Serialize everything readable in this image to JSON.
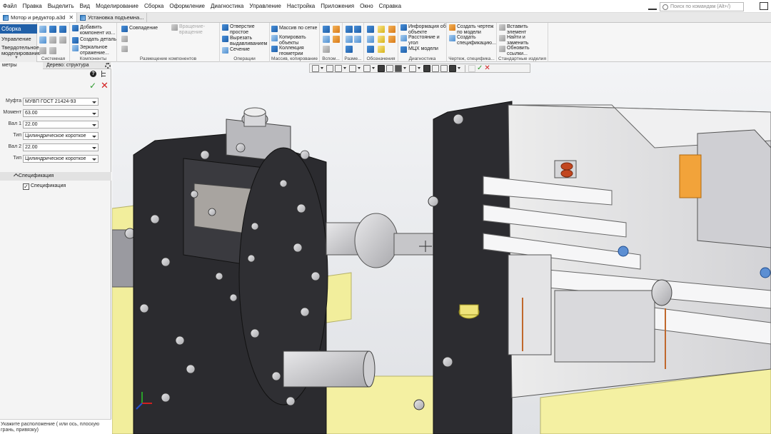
{
  "menu": [
    "Файл",
    "Правка",
    "Выделить",
    "Вид",
    "Моделирование",
    "Сборка",
    "Оформление",
    "Диагностика",
    "Управление",
    "Настройка",
    "Приложения",
    "Окно",
    "Справка"
  ],
  "search": {
    "placeholder": "Поиск по командам (Alt+/)"
  },
  "tabs": [
    {
      "label": "Мотор и редуктор.a3d",
      "active": true
    },
    {
      "label": "Установка подъемна...",
      "active": false
    }
  ],
  "ribbon": {
    "modes": {
      "active": "Сборка",
      "item1": "Управление",
      "item2a": "Твердотельное",
      "item2b": "моделирование"
    },
    "groups": {
      "system": "Системная",
      "components": "Компоненты",
      "placement": "Размещение компонентов",
      "operations": "Операции",
      "arrays": "Массив, копирование",
      "aux": "Вспом...",
      "dims": "Разме...",
      "notation": "Обозначения",
      "diagnostics": "Диагностика",
      "drawing": "Чертеж, специфика...",
      "standard": "Стандартные изделия"
    },
    "buttons": {
      "add_component_1": "Добавить",
      "add_component_2": "компонент из...",
      "create_part": "Создать деталь",
      "mirror_1": "Зеркальное",
      "mirror_2": "отражение...",
      "coincidence": "Совпадение",
      "rotation_1": "Вращение-",
      "rotation_2": "вращение",
      "hole_1": "Отверстие",
      "hole_2": "простое",
      "cut_1": "Вырезать",
      "cut_2": "выдавливанием",
      "section": "Сечение",
      "grid_array": "Массив по сетке",
      "copy_objects_1": "Копировать",
      "copy_objects_2": "объекты",
      "geometry_collection_1": "Коллекция",
      "geometry_collection_2": "геометрии",
      "object_info_1": "Информация об",
      "object_info_2": "объекте",
      "distance_angle_1": "Расстояние и",
      "distance_angle_2": "угол",
      "mass_props": "МЦХ модели",
      "create_drawing_1": "Создать чертеж",
      "create_drawing_2": "по модели",
      "create_spec_1": "Создать",
      "create_spec_2": "спецификацию...",
      "insert_element_1": "Вставить",
      "insert_element_2": "элемент",
      "find_replace_1": "Найти и",
      "find_replace_2": "заменить",
      "update_links_1": "Обновить",
      "update_links_2": "ссылки..."
    }
  },
  "panel": {
    "tab_params": "метры",
    "tab_tree": "Дерево: структура",
    "fields": [
      {
        "label": "Муфта",
        "value": "МУВП ГОСТ 21424-93"
      },
      {
        "label": "Момент",
        "value": "63.00"
      },
      {
        "label": "Вал 1",
        "value": "22.00"
      },
      {
        "label": "Тип",
        "value": "Цилиндрическое короткое"
      },
      {
        "label": "Вал 2",
        "value": "22.00"
      },
      {
        "label": "Тип",
        "value": "Цилиндрическое короткое"
      }
    ],
    "spec_section": "Спецификация",
    "spec_checkbox": "Спецификация",
    "hint": "Укажите расположение ( или ось, плоскую грань, привязку)"
  },
  "colors": {
    "ribbon_active": "#2160a8",
    "ok": "#2e9a2e",
    "cancel": "#d32020",
    "frame_yellow": "#f5f1a1",
    "gearbox_dark": "#2a2a2e",
    "accent_orange": "#f2a33a"
  }
}
